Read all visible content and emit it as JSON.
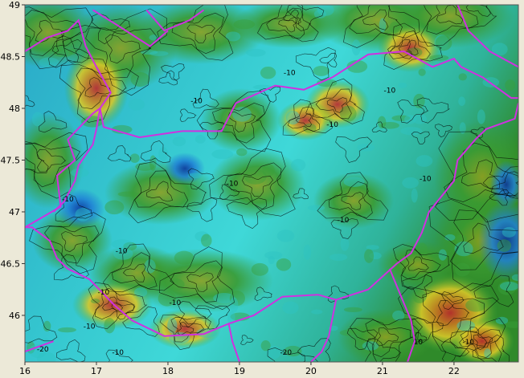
{
  "chart_data": {
    "type": "heatmap",
    "title": "",
    "xlabel": "",
    "ylabel": "",
    "xlim": [
      16,
      22.9
    ],
    "ylim": [
      45.55,
      49
    ],
    "x_ticks": [
      16,
      17,
      18,
      19,
      20,
      21,
      22
    ],
    "y_ticks": [
      46,
      46.5,
      47,
      47.5,
      48,
      48.5,
      49
    ],
    "colormap": [
      "#0a2f9e",
      "#1f7fd6",
      "#2fd6e0",
      "#34c79a",
      "#3aa83a",
      "#2f8a2a",
      "#a8b020",
      "#d8c828",
      "#c87a20",
      "#c0282a"
    ],
    "contour_lines": "black",
    "contour_labels": [
      {
        "text": "-10",
        "x": 19.7,
        "y": 48.32
      },
      {
        "text": "-10",
        "x": 20.3,
        "y": 47.82
      },
      {
        "text": "-10",
        "x": 18.9,
        "y": 47.25
      },
      {
        "text": "-10",
        "x": 17.35,
        "y": 46.6
      },
      {
        "text": "-10",
        "x": 17.1,
        "y": 46.2
      },
      {
        "text": "-10",
        "x": 16.9,
        "y": 45.87
      },
      {
        "text": "-20",
        "x": 16.25,
        "y": 45.65
      },
      {
        "text": "-10",
        "x": 17.3,
        "y": 45.62
      },
      {
        "text": "-20",
        "x": 19.65,
        "y": 45.62
      },
      {
        "text": "-10",
        "x": 20.45,
        "y": 46.9
      },
      {
        "text": "-10",
        "x": 21.6,
        "y": 47.3
      },
      {
        "text": "-10",
        "x": 16.6,
        "y": 47.1
      },
      {
        "text": "-10",
        "x": 18.4,
        "y": 48.05
      },
      {
        "text": "-10",
        "x": 21.1,
        "y": 48.15
      },
      {
        "text": "10",
        "x": 21.5,
        "y": 45.72
      },
      {
        "text": "-10",
        "x": 22.2,
        "y": 45.72
      },
      {
        "text": "-10",
        "x": 18.1,
        "y": 46.1
      }
    ],
    "boundary_color": "#d030e0",
    "grid": false,
    "legend": "none"
  }
}
